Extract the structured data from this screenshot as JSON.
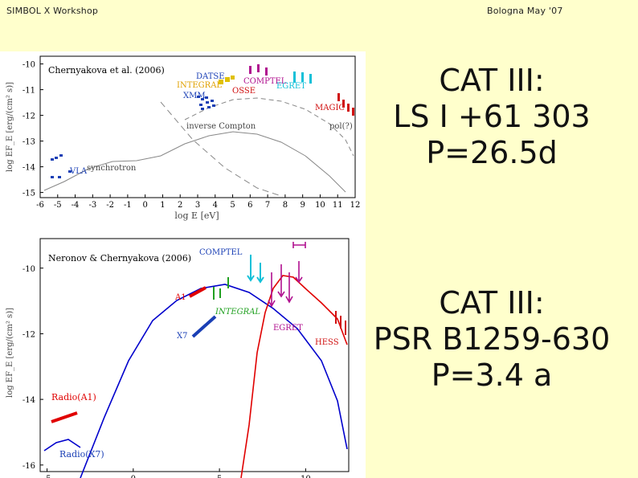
{
  "header": {
    "left": "SIMBOL X Workshop",
    "right": "Bologna May '07"
  },
  "slide_text_1": [
    "CAT III:",
    "LS I +61 303",
    "P=26.5d"
  ],
  "slide_text_2": [
    "CAT III:",
    "PSR B1259-630",
    "P=3.4 a"
  ],
  "colors": {
    "background": "#ffffcc",
    "red_curve": "#e00000",
    "blue_curve": "#0000cc"
  },
  "chart_data": [
    {
      "type": "scatter",
      "annotation": "Chernyakova et al. (2006)",
      "xlabel": "log E [eV]",
      "ylabel": "log EF_E [erg/(cm² s)]",
      "xticks": [
        "-6",
        "-5",
        "-4",
        "-3",
        "-2",
        "-1",
        "0",
        "1",
        "2",
        "3",
        "4",
        "5",
        "6",
        "7",
        "8",
        "9",
        "10",
        "11",
        "12"
      ],
      "yticks": [
        "-10",
        "-11",
        "-12",
        "-13",
        "-14",
        "-15"
      ],
      "xlim": [
        -6,
        12
      ],
      "ylim": [
        -15.2,
        -9.7
      ],
      "labels": [
        "DATSE",
        "INTEGRAL",
        "XMM",
        "COMPTEL",
        "OSSE",
        "EGRET",
        "MAGIC",
        "inverse Compton",
        "synchrotron",
        "VLA",
        "pol(?)"
      ]
    },
    {
      "type": "line",
      "annotation": "Neronov & Chernyakova (2006)",
      "ylabel": "log EF_E [erg/(cm² s)]",
      "xticks": [
        "-5",
        "0",
        "5",
        "10"
      ],
      "yticks": [
        "-10",
        "-12",
        "-14",
        "-16"
      ],
      "xlim": [
        -5.4,
        12.5
      ],
      "ylim": [
        -16.2,
        -9.1
      ],
      "labels": [
        "COMPTEL",
        "A1",
        "INTEGRAL",
        "X7",
        "EGRET",
        "HESS",
        "Radio(A1)",
        "Radio(X7)"
      ]
    }
  ]
}
